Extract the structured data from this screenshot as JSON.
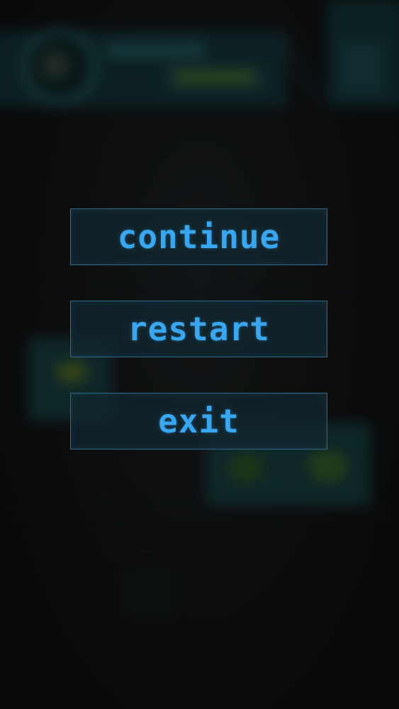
{
  "pause_menu": {
    "continue_label": "continue",
    "restart_label": "restart",
    "exit_label": "exit"
  },
  "colors": {
    "background": "#0a0b0c",
    "button_fill": "#12263a",
    "button_border": "#2f6b8c",
    "button_text": "#39a6f0"
  }
}
